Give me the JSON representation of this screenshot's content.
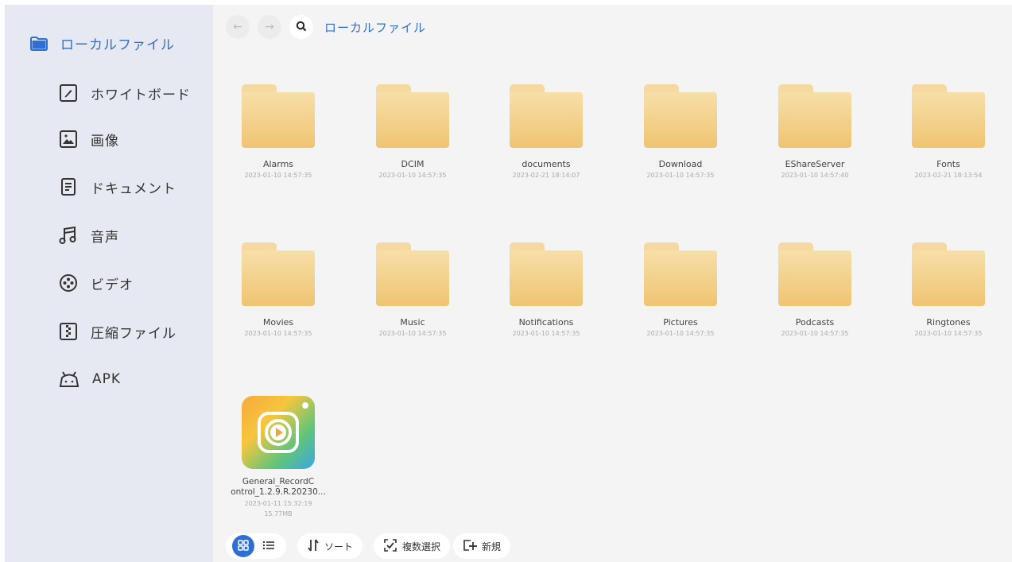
{
  "sidebar": {
    "root_label": "ローカルファイル",
    "items": [
      {
        "label": "ホワイトボード",
        "icon": "whiteboard-icon"
      },
      {
        "label": "画像",
        "icon": "image-icon"
      },
      {
        "label": "ドキュメント",
        "icon": "document-icon"
      },
      {
        "label": "音声",
        "icon": "music-icon"
      },
      {
        "label": "ビデオ",
        "icon": "video-icon"
      },
      {
        "label": "圧縮ファイル",
        "icon": "zip-icon"
      },
      {
        "label": "APK",
        "icon": "android-icon"
      }
    ]
  },
  "topbar": {
    "back": "←",
    "forward": "→",
    "breadcrumb": "ローカルファイル"
  },
  "files": [
    {
      "name": "Alarms",
      "date": "2023-01-10 14:57:35"
    },
    {
      "name": "DCIM",
      "date": "2023-01-10 14:57:35"
    },
    {
      "name": "documents",
      "date": "2023-02-21 18:14:07"
    },
    {
      "name": "Download",
      "date": "2023-01-10 14:57:35"
    },
    {
      "name": "EShareServer",
      "date": "2023-01-10 14:57:40"
    },
    {
      "name": "Fonts",
      "date": "2023-02-21 18:13:54"
    },
    {
      "name": "Movies",
      "date": "2023-01-10 14:57:35"
    },
    {
      "name": "Music",
      "date": "2023-01-10 14:57:35"
    },
    {
      "name": "Notifications",
      "date": "2023-01-10 14:57:35"
    },
    {
      "name": "Pictures",
      "date": "2023-01-10 14:57:35"
    },
    {
      "name": "Podcasts",
      "date": "2023-01-10 14:57:35"
    },
    {
      "name": "Ringtones",
      "date": "2023-01-10 14:57:35"
    }
  ],
  "app_file": {
    "name_line1": "General_RecordC",
    "name_line2": "ontrol_1.2.9.R.20230...",
    "date": "2023-01-11 15:32:19",
    "size": "15.77MB"
  },
  "bottombar": {
    "sort_label": "ソート",
    "multiselect_label": "複数選択",
    "new_label": "新規"
  },
  "colors": {
    "accent": "#2f6fd3",
    "sidebar_bg": "#e6e9f1",
    "folder": "#f2cd86"
  }
}
